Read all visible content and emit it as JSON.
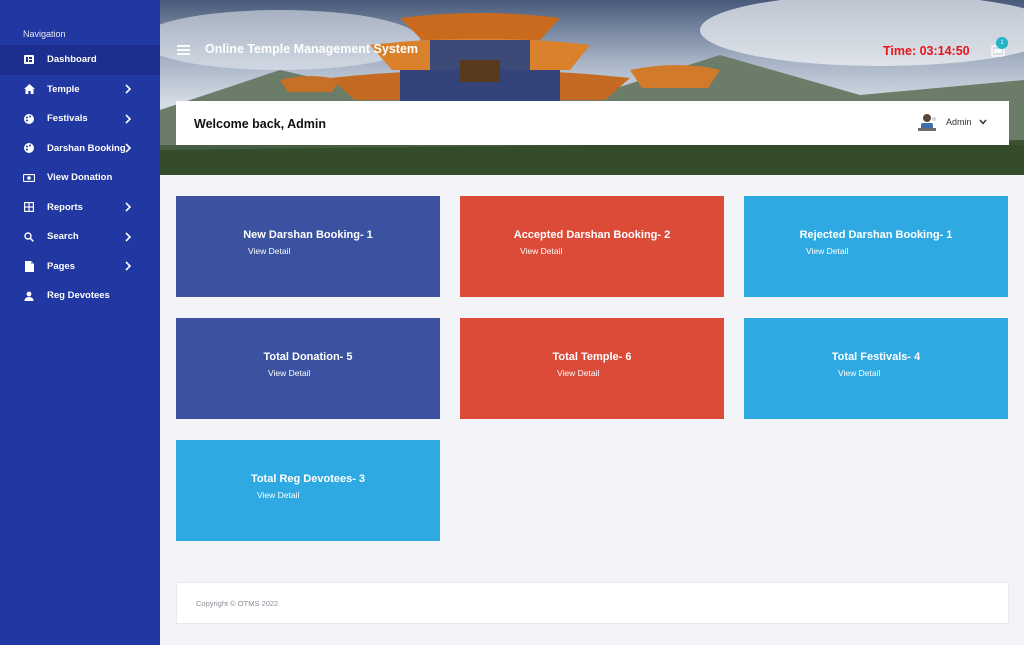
{
  "sidebar": {
    "heading": "Navigation",
    "items": [
      {
        "label": "Dashboard",
        "icon": "dashboard-icon",
        "active": true
      },
      {
        "label": "Temple",
        "icon": "home-icon",
        "has_submenu": true
      },
      {
        "label": "Festivals",
        "icon": "palette-icon",
        "has_submenu": true
      },
      {
        "label": "Darshan Booking",
        "icon": "palette-icon",
        "has_submenu": true
      },
      {
        "label": "View Donation",
        "icon": "money-icon"
      },
      {
        "label": "Reports",
        "icon": "grid-icon",
        "has_submenu": true
      },
      {
        "label": "Search",
        "icon": "search-icon",
        "has_submenu": true
      },
      {
        "label": "Pages",
        "icon": "page-icon",
        "has_submenu": true
      },
      {
        "label": "Reg Devotees",
        "icon": "user-icon"
      }
    ]
  },
  "header": {
    "title": "Online Temple Management System",
    "time": "Time: 03:14:50",
    "notification_count": "1",
    "welcome": "Welcome back, Admin",
    "user_name": "Admin"
  },
  "cards": [
    {
      "title": "New Darshan Booking- 1",
      "link": "View Detail",
      "color": "#3a52a0"
    },
    {
      "title": "Accepted Darshan Booking- 2",
      "link": "View Detail",
      "color": "#dc4a38"
    },
    {
      "title": "Rejected Darshan Booking- 1",
      "link": "View Detail",
      "color": "#2ea9e2"
    },
    {
      "title": "Total Donation- 5",
      "link": "View Detail",
      "color": "#3a52a0"
    },
    {
      "title": "Total Temple- 6",
      "link": "View Detail",
      "color": "#dc4a38"
    },
    {
      "title": "Total Festivals- 4",
      "link": "View Detail",
      "color": "#2ea9e2"
    },
    {
      "title": "Total Reg Devotees- 3",
      "link": "View Detail",
      "color": "#2ea9e2"
    }
  ],
  "footer": {
    "copyright": "Copyright © OTMS 2022"
  },
  "colors": {
    "sidebar_bg": "#2137a1",
    "time_red": "#e8141b",
    "badge": "#22b3c8"
  }
}
